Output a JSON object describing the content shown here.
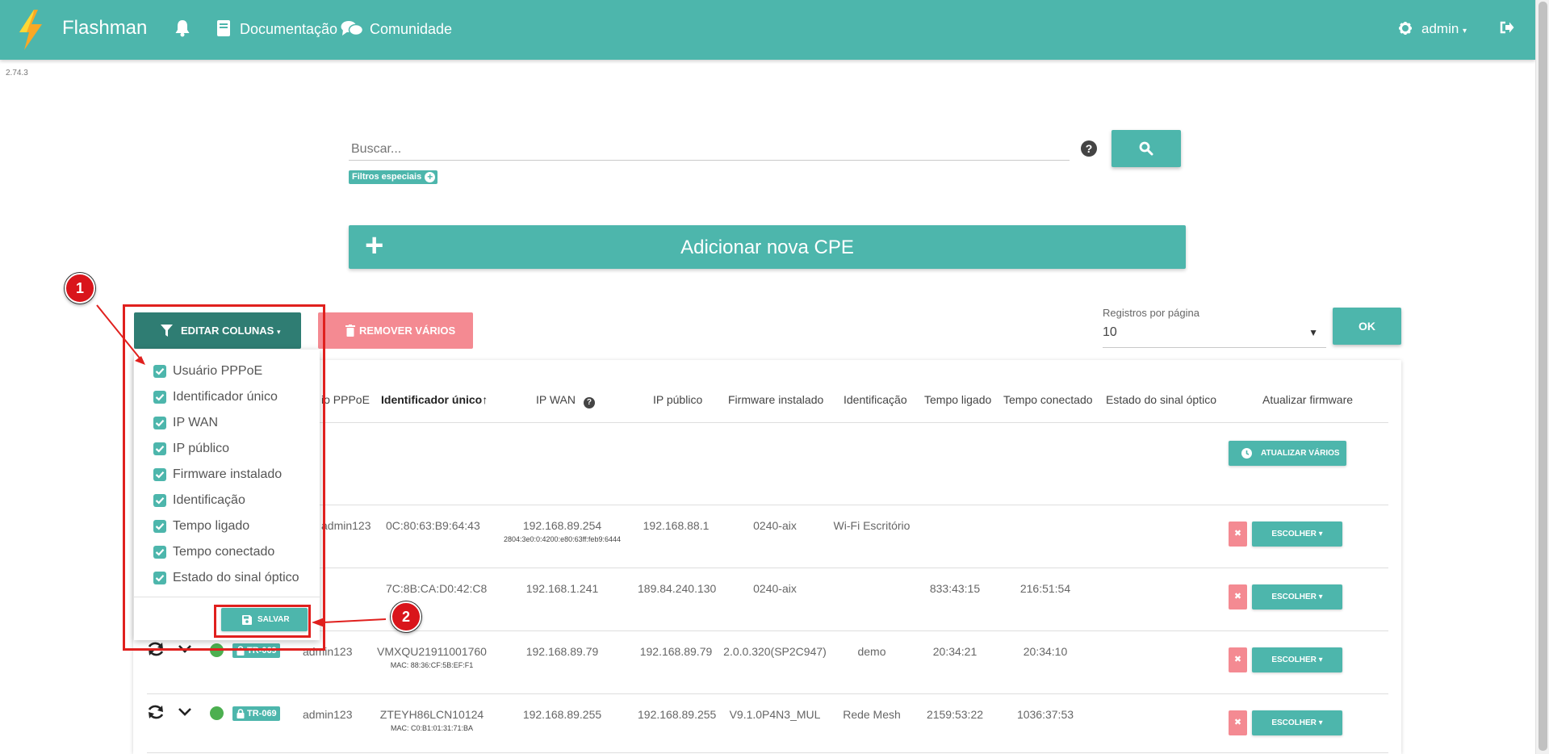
{
  "app": {
    "brand": "Flashman",
    "version": "2.74.3"
  },
  "nav": {
    "docs": "Documentação",
    "community": "Comunidade",
    "user": "admin"
  },
  "search": {
    "placeholder": "Buscar...",
    "special_filters": "Filtros especiais"
  },
  "actions": {
    "add_cpe": "Adicionar nova CPE",
    "edit_columns": "EDITAR COLUNAS",
    "remove_many": "REMOVER VÁRIOS",
    "update_many": "ATUALIZAR VÁRIOS",
    "choose": "ESCOLHER",
    "save": "SALVAR",
    "ok": "OK"
  },
  "pagination": {
    "label": "Registros por página",
    "value": "10"
  },
  "columns_menu": [
    "Usuário PPPoE",
    "Identificador único",
    "IP WAN",
    "IP público",
    "Firmware instalado",
    "Identificação",
    "Tempo ligado",
    "Tempo conectado",
    "Estado do sinal óptico"
  ],
  "table": {
    "headers": {
      "pppoe": "io PPPoE",
      "uid": "Identificador único↑",
      "wan": "IP WAN",
      "public_ip": "IP público",
      "firmware": "Firmware instalado",
      "ident": "Identificação",
      "uptime": "Tempo ligado",
      "conn_time": "Tempo conectado",
      "optical": "Estado do sinal óptico",
      "update_fw": "Atualizar firmware"
    },
    "rows": [
      {
        "pppoe": "admin123",
        "uid": "0C:80:63:B9:64:43",
        "uid_sub": "",
        "wan": "192.168.89.254",
        "wan_sub": "2804:3e0:0:4200:e80:63ff:feb9:6444",
        "public_ip": "192.168.88.1",
        "firmware": "0240-aix",
        "ident": "Wi-Fi Escritório",
        "uptime": "",
        "conn_time": "",
        "badge": ""
      },
      {
        "pppoe": "",
        "uid": "7C:8B:CA:D0:42:C8",
        "uid_sub": "",
        "wan": "192.168.1.241",
        "wan_sub": "",
        "public_ip": "189.84.240.130",
        "firmware": "0240-aix",
        "ident": "",
        "uptime": "833:43:15",
        "conn_time": "216:51:54",
        "badge": ""
      },
      {
        "pppoe": "admin123",
        "uid": "VMXQU21911001760",
        "uid_sub": "MAC: 88:36:CF:5B:EF:F1",
        "wan": "192.168.89.79",
        "wan_sub": "",
        "public_ip": "192.168.89.79",
        "firmware": "2.0.0.320(SP2C947)",
        "ident": "demo",
        "uptime": "20:34:21",
        "conn_time": "20:34:10",
        "badge": "TR-069"
      },
      {
        "pppoe": "admin123",
        "uid": "ZTEYH86LCN10124",
        "uid_sub": "MAC: C0:B1:01:31:71:BA",
        "wan": "192.168.89.255",
        "wan_sub": "",
        "public_ip": "192.168.89.255",
        "firmware": "V9.1.0P4N3_MUL",
        "ident": "Rede Mesh",
        "uptime": "2159:53:22",
        "conn_time": "1036:37:53",
        "badge": "TR-069"
      }
    ]
  },
  "annotations": [
    "1",
    "2"
  ],
  "colors": {
    "primary": "#4db6ac",
    "primary_dark": "#2f7d73",
    "danger": "#f48a92",
    "annotation": "#e0201e",
    "online": "#4caf50"
  }
}
